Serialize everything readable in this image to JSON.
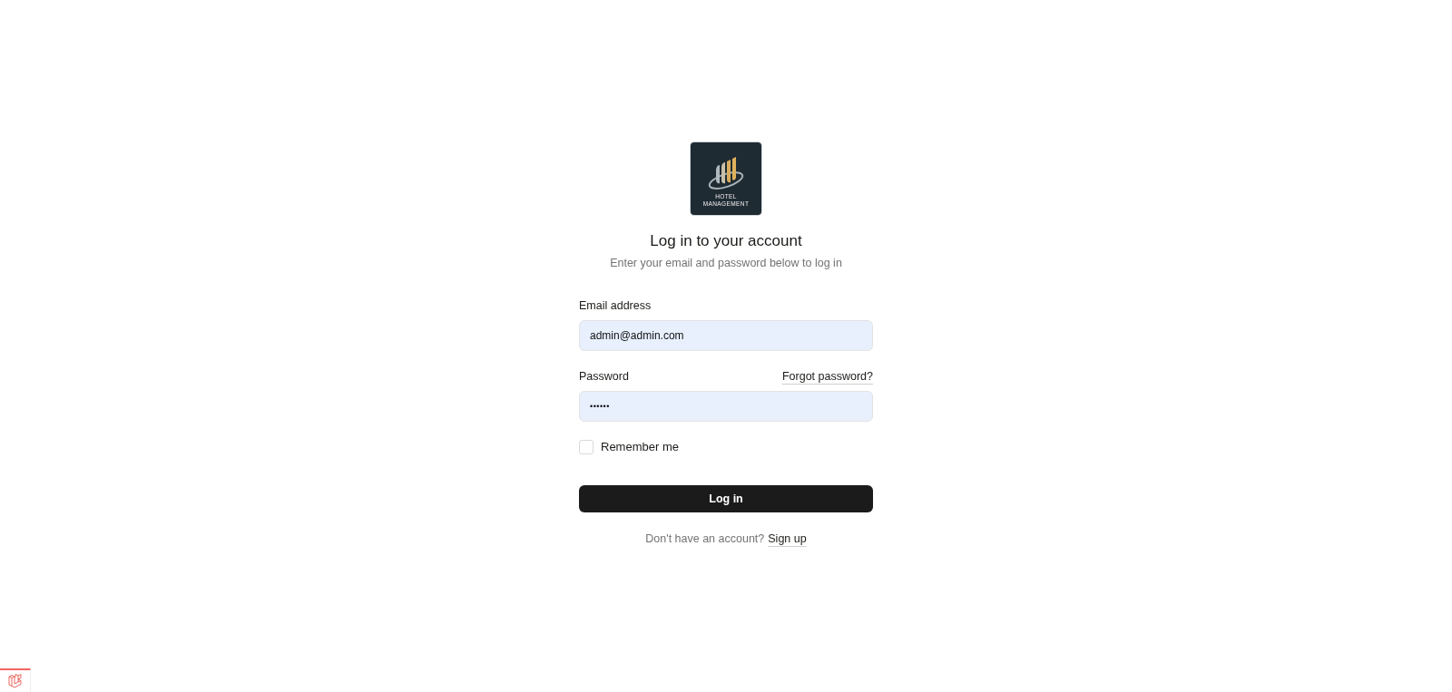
{
  "logo": {
    "text_lines": [
      "HOTEL",
      "MANAGEMENT"
    ]
  },
  "heading": {
    "title": "Log in to your account",
    "subtitle": "Enter your email and password below to log in"
  },
  "form": {
    "fields": [
      {
        "kind": "email",
        "label": "Email address",
        "value": "admin@admin.com"
      },
      {
        "kind": "password",
        "label": "Password",
        "link": "Forgot password?",
        "value": "••••••"
      }
    ],
    "remember": {
      "label": "Remember me",
      "checked": false
    },
    "submit": "Log in"
  },
  "footer": {
    "text": "Don't have an account?",
    "link": "Sign up"
  }
}
